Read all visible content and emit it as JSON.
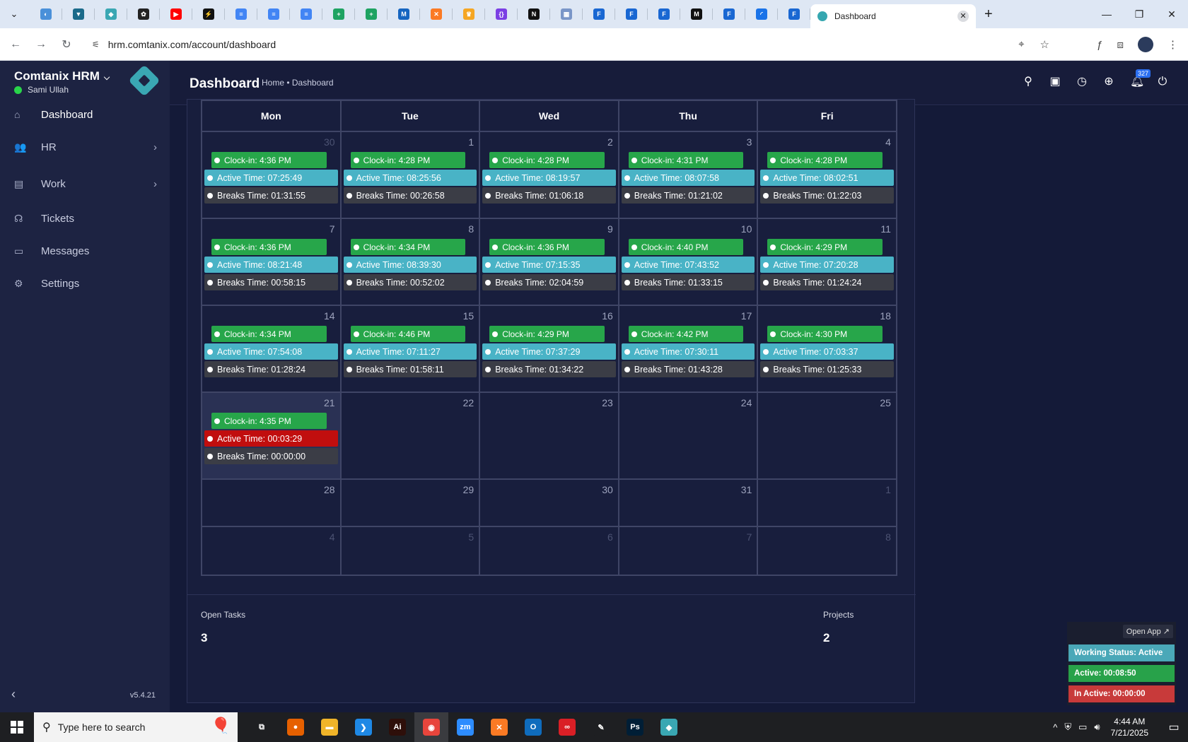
{
  "browser": {
    "active_tab_title": "Dashboard",
    "url": "hrm.comtanix.com/account/dashboard",
    "favicons": [
      {
        "icon": "half-circle-icon",
        "color": "#4a90d9",
        "glyph": "◐"
      },
      {
        "icon": "vpn-icon",
        "color": "#1a6a8a",
        "glyph": "▼"
      },
      {
        "icon": "diamond-icon",
        "color": "#3aa7b3",
        "glyph": "◆"
      },
      {
        "icon": "openai-icon",
        "color": "#222222",
        "glyph": "✿"
      },
      {
        "icon": "youtube-icon",
        "color": "#ff0000",
        "glyph": "▶"
      },
      {
        "icon": "bolt-icon",
        "color": "#111111",
        "glyph": "⚡"
      },
      {
        "icon": "docs-icon",
        "color": "#4285f4",
        "glyph": "≡"
      },
      {
        "icon": "docs-icon",
        "color": "#4285f4",
        "glyph": "≡"
      },
      {
        "icon": "docs-icon",
        "color": "#4285f4",
        "glyph": "≡"
      },
      {
        "icon": "sheets-icon",
        "color": "#1ea362",
        "glyph": "+"
      },
      {
        "icon": "sheets-icon",
        "color": "#1ea362",
        "glyph": "+"
      },
      {
        "icon": "chart-icon",
        "color": "#1565c0",
        "glyph": "M"
      },
      {
        "icon": "xampp-icon",
        "color": "#fb7a24",
        "glyph": "✕"
      },
      {
        "icon": "crown-icon",
        "color": "#f5a623",
        "glyph": "♛"
      },
      {
        "icon": "brackets-icon",
        "color": "#7b3fe4",
        "glyph": "{}"
      },
      {
        "icon": "nextjs-icon",
        "color": "#111111",
        "glyph": "N"
      },
      {
        "icon": "grid-icon",
        "color": "#7a96c8",
        "glyph": "▦"
      },
      {
        "icon": "forms-icon",
        "color": "#1967d2",
        "glyph": "F"
      },
      {
        "icon": "forms-icon",
        "color": "#1967d2",
        "glyph": "F"
      },
      {
        "icon": "forms-icon",
        "color": "#1967d2",
        "glyph": "F"
      },
      {
        "icon": "medium-icon",
        "color": "#111111",
        "glyph": "M"
      },
      {
        "icon": "forms-icon",
        "color": "#1967d2",
        "glyph": "F"
      },
      {
        "icon": "loading-icon",
        "color": "#1a73e8",
        "glyph": "◜"
      },
      {
        "icon": "forms-icon",
        "color": "#1967d2",
        "glyph": "F"
      }
    ]
  },
  "sidebar": {
    "brand": "Comtanix HRM",
    "user": "Sami Ullah",
    "version": "v5.4.21",
    "items": [
      {
        "label": "Dashboard",
        "icon": "home-icon",
        "glyph": "⌂",
        "active": true,
        "arrow": false
      },
      {
        "label": "HR",
        "icon": "users-icon",
        "glyph": "👥",
        "active": false,
        "arrow": true
      },
      {
        "label": "Work",
        "icon": "briefcase-icon",
        "glyph": "▤",
        "active": false,
        "arrow": true
      },
      {
        "label": "Tickets",
        "icon": "headset-icon",
        "glyph": "☊",
        "active": false,
        "arrow": false
      },
      {
        "label": "Messages",
        "icon": "message-icon",
        "glyph": "▭",
        "active": false,
        "arrow": false
      },
      {
        "label": "Settings",
        "icon": "gear-icon",
        "glyph": "⚙",
        "active": false,
        "arrow": false
      }
    ]
  },
  "header": {
    "title": "Dashboard",
    "breadcrumb": "Home • Dashboard",
    "notification_count": "327"
  },
  "calendar": {
    "days": [
      "Mon",
      "Tue",
      "Wed",
      "Thu",
      "Fri"
    ],
    "weeks": [
      [
        {
          "num": "30",
          "other": true,
          "clock": "Clock-in: 4:36 PM",
          "active": "Active Time: 07:25:49",
          "breaks": "Breaks Time: 01:31:55"
        },
        {
          "num": "1",
          "clock": "Clock-in: 4:28 PM",
          "active": "Active Time: 08:25:56",
          "breaks": "Breaks Time: 00:26:58"
        },
        {
          "num": "2",
          "clock": "Clock-in: 4:28 PM",
          "active": "Active Time: 08:19:57",
          "breaks": "Breaks Time: 01:06:18"
        },
        {
          "num": "3",
          "clock": "Clock-in: 4:31 PM",
          "active": "Active Time: 08:07:58",
          "breaks": "Breaks Time: 01:21:02"
        },
        {
          "num": "4",
          "clock": "Clock-in: 4:28 PM",
          "active": "Active Time: 08:02:51",
          "breaks": "Breaks Time: 01:22:03"
        }
      ],
      [
        {
          "num": "7",
          "clock": "Clock-in: 4:36 PM",
          "active": "Active Time: 08:21:48",
          "breaks": "Breaks Time: 00:58:15"
        },
        {
          "num": "8",
          "clock": "Clock-in: 4:34 PM",
          "active": "Active Time: 08:39:30",
          "breaks": "Breaks Time: 00:52:02"
        },
        {
          "num": "9",
          "clock": "Clock-in: 4:36 PM",
          "active": "Active Time: 07:15:35",
          "breaks": "Breaks Time: 02:04:59"
        },
        {
          "num": "10",
          "clock": "Clock-in: 4:40 PM",
          "active": "Active Time: 07:43:52",
          "breaks": "Breaks Time: 01:33:15"
        },
        {
          "num": "11",
          "clock": "Clock-in: 4:29 PM",
          "active": "Active Time: 07:20:28",
          "breaks": "Breaks Time: 01:24:24"
        }
      ],
      [
        {
          "num": "14",
          "clock": "Clock-in: 4:34 PM",
          "active": "Active Time: 07:54:08",
          "breaks": "Breaks Time: 01:28:24"
        },
        {
          "num": "15",
          "clock": "Clock-in: 4:46 PM",
          "active": "Active Time: 07:11:27",
          "breaks": "Breaks Time: 01:58:11"
        },
        {
          "num": "16",
          "clock": "Clock-in: 4:29 PM",
          "active": "Active Time: 07:37:29",
          "breaks": "Breaks Time: 01:34:22"
        },
        {
          "num": "17",
          "clock": "Clock-in: 4:42 PM",
          "active": "Active Time: 07:30:11",
          "breaks": "Breaks Time: 01:43:28"
        },
        {
          "num": "18",
          "clock": "Clock-in: 4:30 PM",
          "active": "Active Time: 07:03:37",
          "breaks": "Breaks Time: 01:25:33"
        }
      ],
      [
        {
          "num": "21",
          "today": true,
          "clock": "Clock-in: 4:35 PM",
          "active": "Active Time: 00:03:29",
          "active_red": true,
          "breaks": "Breaks Time: 00:00:00"
        },
        {
          "num": "22"
        },
        {
          "num": "23"
        },
        {
          "num": "24"
        },
        {
          "num": "25"
        }
      ],
      [
        {
          "num": "28"
        },
        {
          "num": "29"
        },
        {
          "num": "30"
        },
        {
          "num": "31"
        },
        {
          "num": "1",
          "other": true
        }
      ],
      [
        {
          "num": "4",
          "other": true
        },
        {
          "num": "5",
          "other": true
        },
        {
          "num": "6",
          "other": true
        },
        {
          "num": "7",
          "other": true
        },
        {
          "num": "8",
          "other": true
        }
      ]
    ]
  },
  "stats": {
    "open_tasks_label": "Open Tasks",
    "open_tasks_value": "3",
    "projects_label": "Projects",
    "projects_value": "2"
  },
  "widget": {
    "open_app": "Open App ↗",
    "working_status": "Working Status: Active",
    "active": "Active: 00:08:50",
    "inactive": "In Active: 00:00:00"
  },
  "taskbar": {
    "search_placeholder": "Type here to search",
    "time": "4:44 AM",
    "date": "7/21/2025",
    "apps": [
      {
        "icon": "task-view-icon",
        "color": "#1e1f22",
        "glyph": "⧉"
      },
      {
        "icon": "firefox-icon",
        "color": "#e66000",
        "glyph": "●"
      },
      {
        "icon": "file-explorer-icon",
        "color": "#f0b429",
        "glyph": "▬"
      },
      {
        "icon": "vscode-icon",
        "color": "#1e88e5",
        "glyph": "❯"
      },
      {
        "icon": "illustrator-icon",
        "color": "#2e0f0a",
        "glyph": "Ai"
      },
      {
        "icon": "chrome-icon",
        "color": "#e8453c",
        "glyph": "◉",
        "current": true
      },
      {
        "icon": "zoom-icon",
        "color": "#2d8cff",
        "glyph": "zm"
      },
      {
        "icon": "xampp-icon",
        "color": "#fb7a24",
        "glyph": "✕"
      },
      {
        "icon": "outlook-icon",
        "color": "#0f6cbd",
        "glyph": "O"
      },
      {
        "icon": "creative-cloud-icon",
        "color": "#da1f26",
        "glyph": "∞"
      },
      {
        "icon": "pen-tool-icon",
        "color": "#1e1f22",
        "glyph": "✎"
      },
      {
        "icon": "photoshop-icon",
        "color": "#001e36",
        "glyph": "Ps"
      },
      {
        "icon": "hrm-app-icon",
        "color": "#3aa7b3",
        "glyph": "◆"
      }
    ]
  }
}
